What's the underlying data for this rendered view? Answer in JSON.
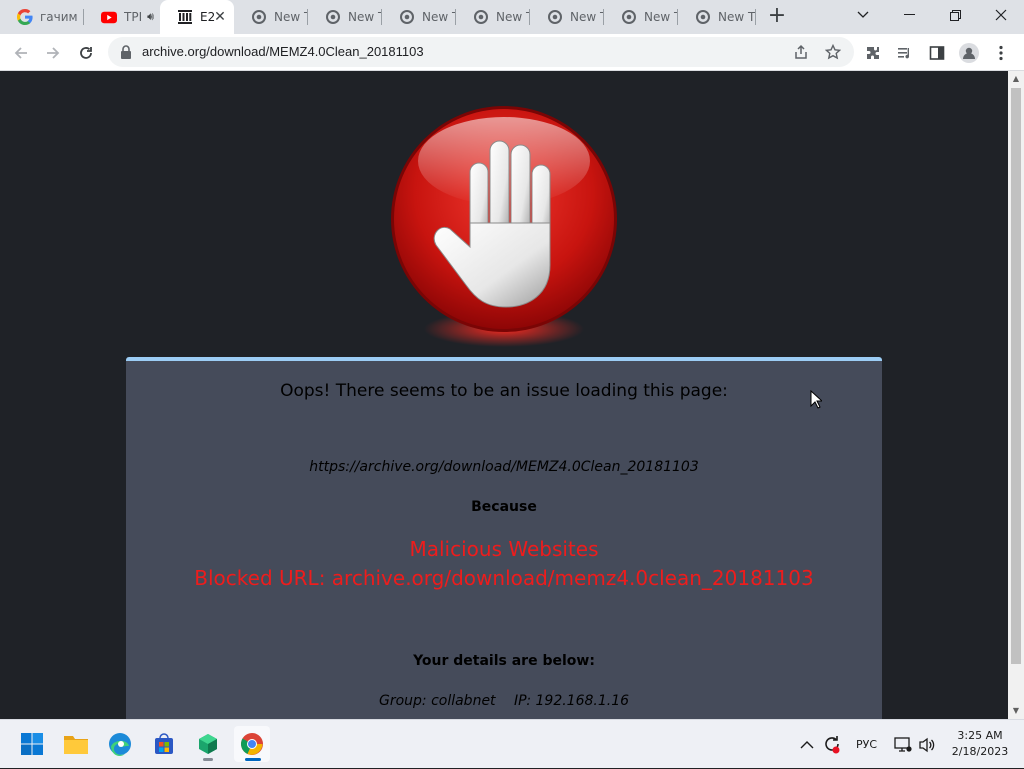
{
  "browser": {
    "tabs": [
      {
        "label": "гачим",
        "icon": "google-icon",
        "active": false
      },
      {
        "label": "TPI",
        "icon": "youtube-icon",
        "active": false,
        "audio": true
      },
      {
        "label": "E2",
        "icon": "archive-icon",
        "active": true
      },
      {
        "label": "New T",
        "icon": "chrome-icon",
        "active": false
      },
      {
        "label": "New T",
        "icon": "chrome-icon",
        "active": false
      },
      {
        "label": "New T",
        "icon": "chrome-icon",
        "active": false
      },
      {
        "label": "New T",
        "icon": "chrome-icon",
        "active": false
      },
      {
        "label": "New T",
        "icon": "chrome-icon",
        "active": false
      },
      {
        "label": "New T",
        "icon": "chrome-icon",
        "active": false
      },
      {
        "label": "New T",
        "icon": "chrome-icon",
        "active": false
      }
    ],
    "new_tab_label": "+",
    "address": "archive.org/download/MEMZ4.0Clean_20181103"
  },
  "page": {
    "heading": "Oops! There seems to be an issue loading this page:",
    "blocked_url": "https://archive.org/download/MEMZ4.0Clean_20181103",
    "because": "Because",
    "category": "Malicious Websites",
    "reason": "Blocked URL: archive.org/download/memz4.0clean_20181103",
    "details_title": "Your details are below:",
    "group": "Group: collabnet",
    "ip": "IP: 192.168.1.16",
    "colors": {
      "panel": "#454b5a",
      "accent": "#9ccdf5",
      "warning": "#ee1c1c",
      "background": "#1f2227"
    }
  },
  "taskbar": {
    "apps": [
      "windows-start-icon",
      "file-explorer-icon",
      "edge-icon",
      "store-icon",
      "app-cube-icon",
      "chrome-icon"
    ],
    "language": "РУС",
    "time": "3:25 AM",
    "date": "2/18/2023"
  }
}
